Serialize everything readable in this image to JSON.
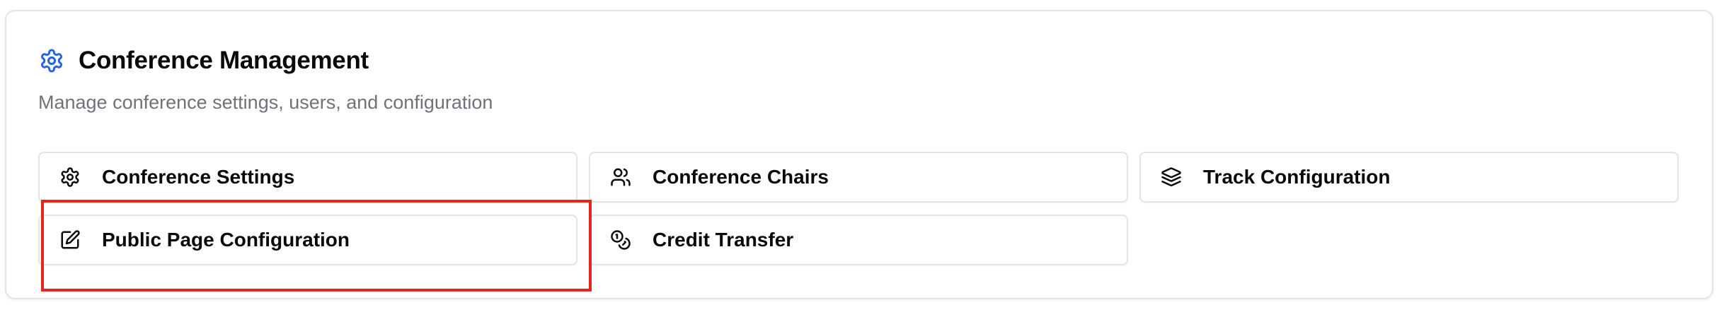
{
  "header": {
    "title": "Conference Management",
    "subtitle": "Manage conference settings, users, and configuration",
    "icon": "gear-icon",
    "accent_color": "#2563eb"
  },
  "buttons": [
    {
      "label": "Conference Settings",
      "icon": "gear-icon"
    },
    {
      "label": "Conference Chairs",
      "icon": "users-icon"
    },
    {
      "label": "Track Configuration",
      "icon": "layers-icon"
    },
    {
      "label": "Public Page Configuration",
      "icon": "edit-icon"
    },
    {
      "label": "Credit Transfer",
      "icon": "coins-icon"
    }
  ],
  "highlight": {
    "color": "#e8251a"
  }
}
